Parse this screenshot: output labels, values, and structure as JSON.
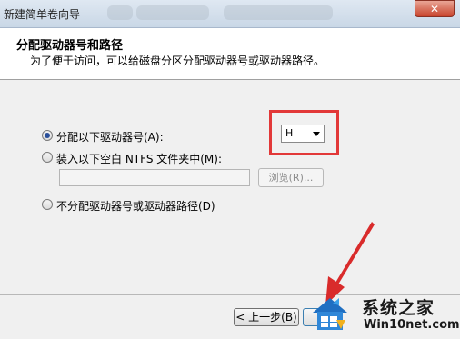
{
  "window": {
    "title": "新建简单卷向导",
    "close_label": "✕"
  },
  "header": {
    "title": "分配驱动器号和路径",
    "subtitle": "为了便于访问，可以给磁盘分区分配驱动器号或驱动器路径。"
  },
  "options": {
    "assign_letter_label": "分配以下驱动器号(A):",
    "mount_folder_label": "装入以下空白 NTFS 文件夹中(M):",
    "no_assign_label": "不分配驱动器号或驱动器路径(D)",
    "selected_letter": "H",
    "path_value": "",
    "browse_label": "浏览(R)..."
  },
  "footer": {
    "back_label": "< 上一步(B)"
  },
  "watermark": {
    "title": "系统之家",
    "url": "Win10net.com"
  },
  "colors": {
    "highlight": "#e23838",
    "arrow": "#d92b2b"
  }
}
